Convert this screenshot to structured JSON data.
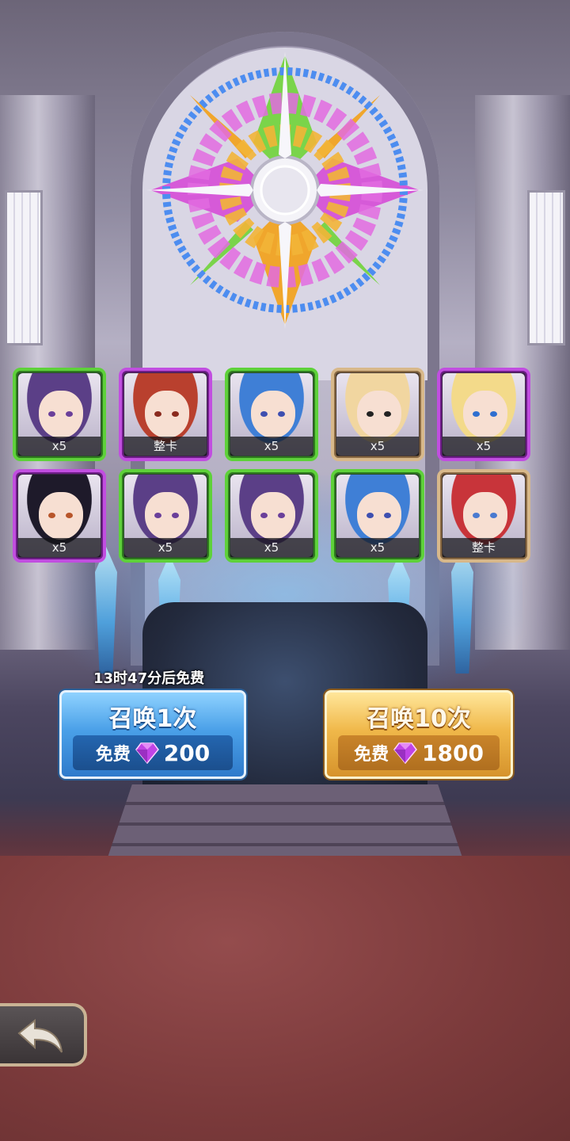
{
  "summon": {
    "timer_text": "13时47分后免费",
    "single": {
      "label": "召唤1次",
      "free_label": "免费",
      "cost": "200"
    },
    "ten": {
      "label": "召唤10次",
      "free_label": "免费",
      "cost": "1800"
    }
  },
  "pool_cards": [
    {
      "label": "x5",
      "rarity_color": "green",
      "hair": "#5b3f87",
      "eye": "#6a3f9a"
    },
    {
      "label": "整卡",
      "rarity_color": "purple",
      "hair": "#b9402e",
      "eye": "#8a2a1e"
    },
    {
      "label": "x5",
      "rarity_color": "green",
      "hair": "#3f7fd6",
      "eye": "#3e4fb0"
    },
    {
      "label": "x5",
      "rarity_color": "gold",
      "hair": "#f1d6a0",
      "eye": "#222222"
    },
    {
      "label": "x5",
      "rarity_color": "purple",
      "hair": "#f3da8a",
      "eye": "#2f6fd0"
    },
    {
      "label": "x5",
      "rarity_color": "purple",
      "hair": "#1e1a2a",
      "eye": "#b8552a"
    },
    {
      "label": "x5",
      "rarity_color": "green",
      "hair": "#5b3f87",
      "eye": "#6a3f9a"
    },
    {
      "label": "x5",
      "rarity_color": "green",
      "hair": "#5b3f87",
      "eye": "#6a3f9a"
    },
    {
      "label": "x5",
      "rarity_color": "green",
      "hair": "#3f7fd6",
      "eye": "#3e4fb0"
    },
    {
      "label": "整卡",
      "rarity_color": "gold",
      "hair": "#c8343a",
      "eye": "#4a7ad0"
    }
  ],
  "back_button": {
    "icon": "back-arrow-icon"
  },
  "gem_icon": "purple-gem-icon"
}
